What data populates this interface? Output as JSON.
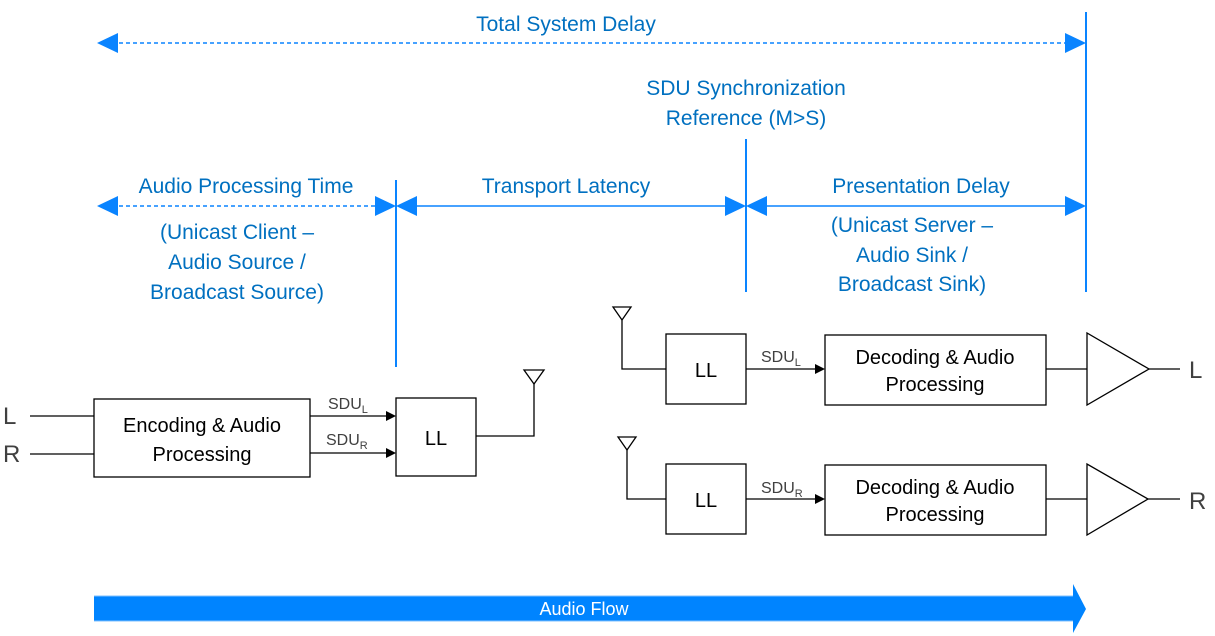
{
  "colors": {
    "accent_blue": "#0A84FF",
    "label_blue": "#0070C0",
    "block_stroke": "#000000",
    "io_text": "#404040",
    "flow_arrow": "#0084FF"
  },
  "timing": {
    "total_system_delay": "Total System Delay",
    "sdu_sync_ref_line1": "SDU Synchronization",
    "sdu_sync_ref_line2": "Reference (M>S)",
    "audio_processing_time": "Audio Processing Time",
    "audio_processing_sub": [
      "(Unicast Client –",
      "Audio Source /",
      "Broadcast Source)"
    ],
    "transport_latency": "Transport Latency",
    "presentation_delay": "Presentation Delay",
    "presentation_sub": [
      "(Unicast Server –",
      "Audio Sink /",
      "Broadcast Sink)"
    ]
  },
  "source": {
    "input_left": "L",
    "input_right": "R",
    "encoder_line1": "Encoding & Audio",
    "encoder_line2": "Processing",
    "sdu_left_main": "SDU",
    "sdu_left_sub": "L",
    "sdu_right_main": "SDU",
    "sdu_right_sub": "R",
    "link_layer": "LL"
  },
  "sinks": [
    {
      "link_layer": "LL",
      "sdu_main": "SDU",
      "sdu_sub": "L",
      "decoder_line1": "Decoding & Audio",
      "decoder_line2": "Processing",
      "output": "L"
    },
    {
      "link_layer": "LL",
      "sdu_main": "SDU",
      "sdu_sub": "R",
      "decoder_line1": "Decoding & Audio",
      "decoder_line2": "Processing",
      "output": "R"
    }
  ],
  "flow": {
    "label": "Audio Flow"
  }
}
